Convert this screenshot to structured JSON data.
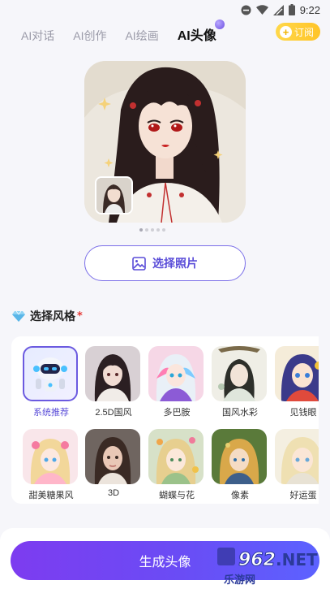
{
  "status_bar": {
    "time": "9:22"
  },
  "tabs": [
    {
      "label": "AI对话",
      "active": false
    },
    {
      "label": "AI创作",
      "active": false
    },
    {
      "label": "AI绘画",
      "active": false
    },
    {
      "label": "AI头像",
      "active": true
    }
  ],
  "subscribe": {
    "label": "订阅"
  },
  "carousel": {
    "dots": 5,
    "active_index": 0
  },
  "choose_photo": {
    "label": "选择照片"
  },
  "style_section": {
    "title": "选择风格",
    "required_mark": "*"
  },
  "styles": [
    {
      "label": "系统推荐",
      "selected": true
    },
    {
      "label": "2.5D国风",
      "selected": false
    },
    {
      "label": "多巴胺",
      "selected": false
    },
    {
      "label": "国风水彩",
      "selected": false
    },
    {
      "label": "见钱眼",
      "selected": false
    },
    {
      "label": "甜美糖果风",
      "selected": false
    },
    {
      "label": "3D",
      "selected": false
    },
    {
      "label": "蝴蝶与花",
      "selected": false
    },
    {
      "label": "像素",
      "selected": false
    },
    {
      "label": "好运蛋",
      "selected": false
    }
  ],
  "generate": {
    "label": "生成头像"
  },
  "watermark": {
    "brand": "962.NET",
    "sub": "乐游网"
  },
  "colors": {
    "accent": "#6b4de0",
    "subscribe": "#ffcc33",
    "required": "#e53935"
  }
}
